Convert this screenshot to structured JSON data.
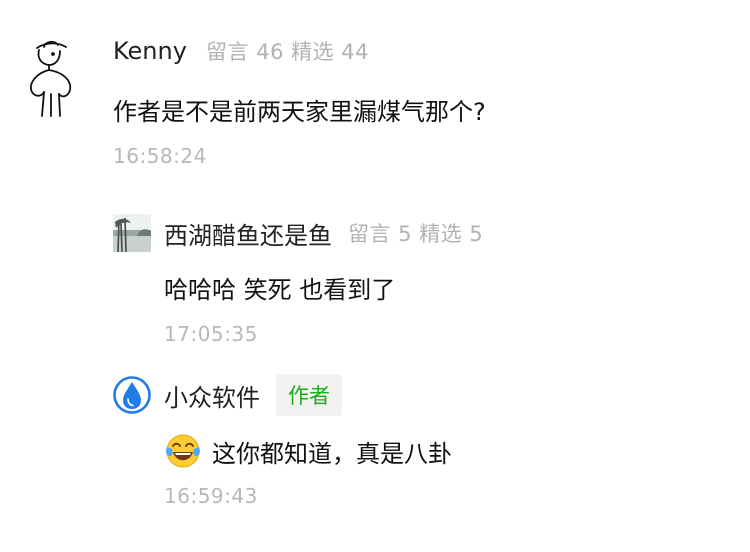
{
  "comment": {
    "author": "Kenny",
    "meta": "留言 46 精选 44",
    "avatar": "line-drawing-person-avatar",
    "content": "作者是不是前两天家里漏煤气那个?",
    "time": "16:58:24"
  },
  "replies": [
    {
      "author": "西湖醋鱼还是鱼",
      "meta": "留言 5 精选 5",
      "avatar": "landscape-photo-avatar",
      "content": "哈哈哈 笑死 也看到了",
      "time": "17:05:35"
    },
    {
      "author": "小众软件",
      "badge": "作者",
      "avatar": "blue-water-drop-avatar",
      "emoji": "face-with-tears-of-joy-emoji",
      "content": "这你都知道，真是八卦",
      "time": "16:59:43"
    }
  ],
  "colors": {
    "name": "#222222",
    "meta": "#b2b2b2",
    "timestamp": "#b8b8b8",
    "badge_text": "#1aad19",
    "badge_bg": "#f2f2f2",
    "drop_blue": "#1f7ce8"
  }
}
